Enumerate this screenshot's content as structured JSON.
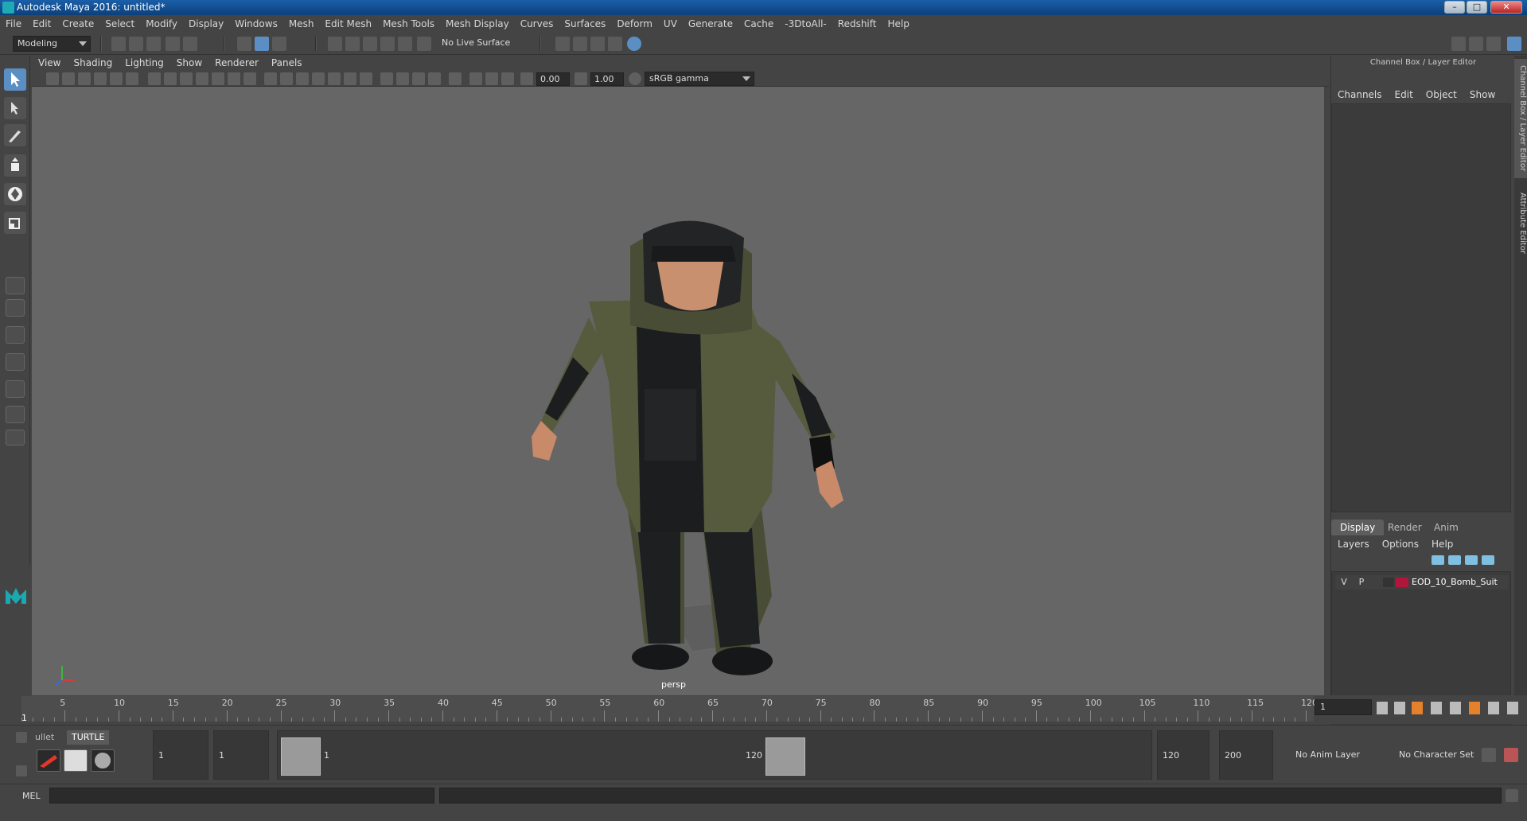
{
  "window": {
    "title": "Autodesk Maya 2016: untitled*"
  },
  "menubar": [
    "File",
    "Edit",
    "Create",
    "Select",
    "Modify",
    "Display",
    "Windows",
    "Mesh",
    "Edit Mesh",
    "Mesh Tools",
    "Mesh Display",
    "Curves",
    "Surfaces",
    "Deform",
    "UV",
    "Generate",
    "Cache",
    "-3DtoAll-",
    "Redshift",
    "Help"
  ],
  "shelf": {
    "mode": "Modeling",
    "live_surface": "No Live Surface"
  },
  "viewport": {
    "menu": [
      "View",
      "Shading",
      "Lighting",
      "Show",
      "Renderer",
      "Panels"
    ],
    "exposure": "0.00",
    "gamma": "1.00",
    "colorspace": "sRGB gamma",
    "camera_label": "persp"
  },
  "channelbox": {
    "header": "Channel Box / Layer Editor",
    "menu": [
      "Channels",
      "Edit",
      "Object",
      "Show"
    ]
  },
  "layer_editor": {
    "tabs": [
      "Display",
      "Render",
      "Anim"
    ],
    "menu": [
      "Layers",
      "Options",
      "Help"
    ],
    "layers": [
      {
        "v": "V",
        "p": "P",
        "name": "EOD_10_Bomb_Suit",
        "color": "#b0163a"
      }
    ]
  },
  "side_tabs": [
    "Channel Box / Layer Editor",
    "Attribute Editor"
  ],
  "timeline": {
    "ticks": [
      "5",
      "10",
      "15",
      "20",
      "25",
      "30",
      "35",
      "40",
      "45",
      "50",
      "55",
      "60",
      "65",
      "70",
      "75",
      "80",
      "85",
      "90",
      "95",
      "100",
      "105",
      "110",
      "115",
      "120"
    ],
    "current": "1",
    "current_field": "1"
  },
  "range": {
    "shelf_tabs": [
      "ullet",
      "TURTLE"
    ],
    "start": "1",
    "playback_start": "1",
    "handle_start": "1",
    "handle_end": "120",
    "playback_end": "120",
    "end": "200",
    "anim_layer": "No Anim Layer",
    "character_set": "No Character Set"
  },
  "command": {
    "lang": "MEL"
  }
}
